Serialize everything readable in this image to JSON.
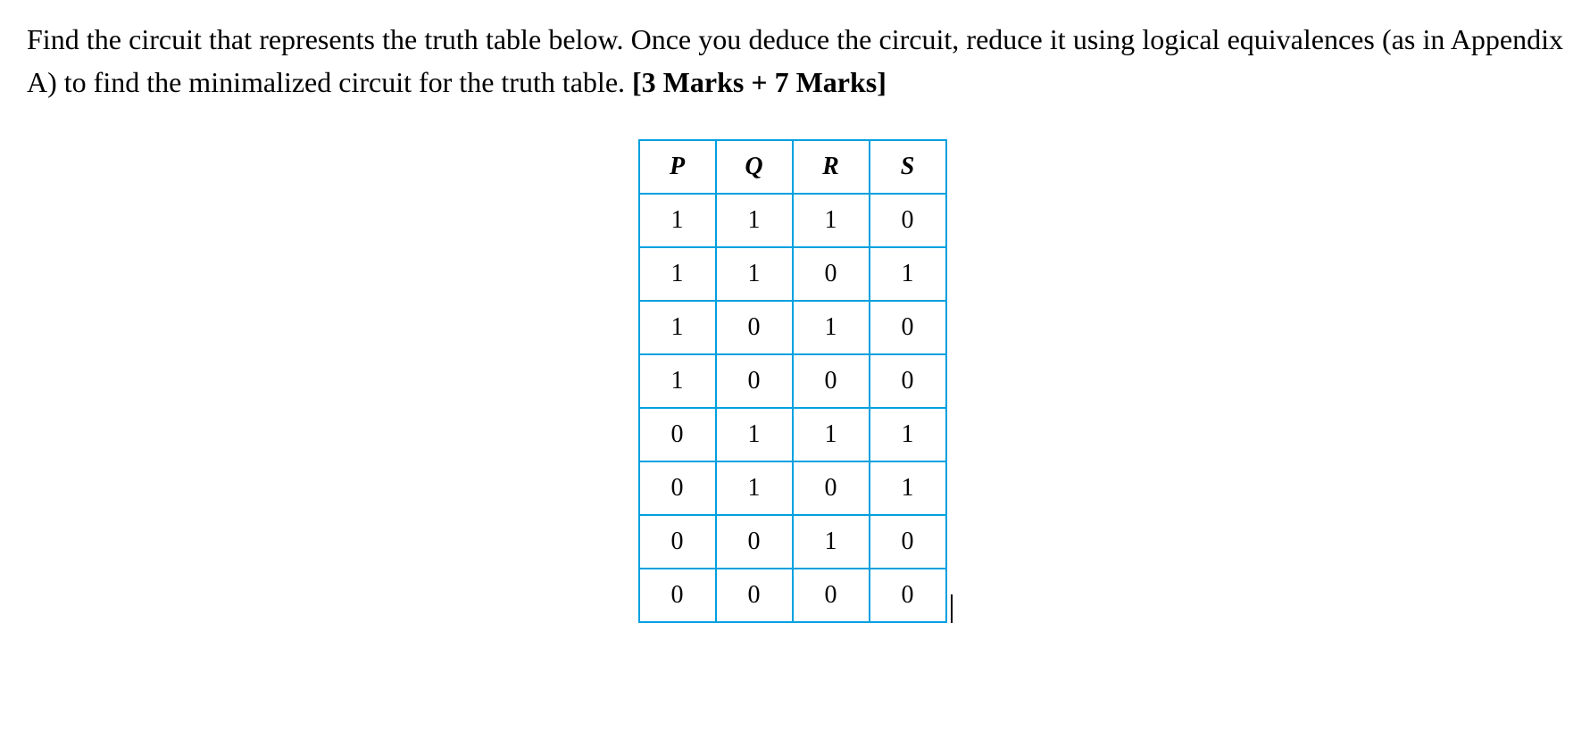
{
  "question": {
    "line1": "Find the circuit that represents the truth table below. Once you deduce the circuit, reduce it using logical equivalences (as in Appendix A) to find the minimalized circuit for the truth table. ",
    "marks": "[3 Marks + 7 Marks]"
  },
  "table": {
    "headers": [
      "P",
      "Q",
      "R",
      "S"
    ],
    "rows": [
      [
        "1",
        "1",
        "1",
        "0"
      ],
      [
        "1",
        "1",
        "0",
        "1"
      ],
      [
        "1",
        "0",
        "1",
        "0"
      ],
      [
        "1",
        "0",
        "0",
        "0"
      ],
      [
        "0",
        "1",
        "1",
        "1"
      ],
      [
        "0",
        "1",
        "0",
        "1"
      ],
      [
        "0",
        "0",
        "1",
        "0"
      ],
      [
        "0",
        "0",
        "0",
        "0"
      ]
    ]
  }
}
